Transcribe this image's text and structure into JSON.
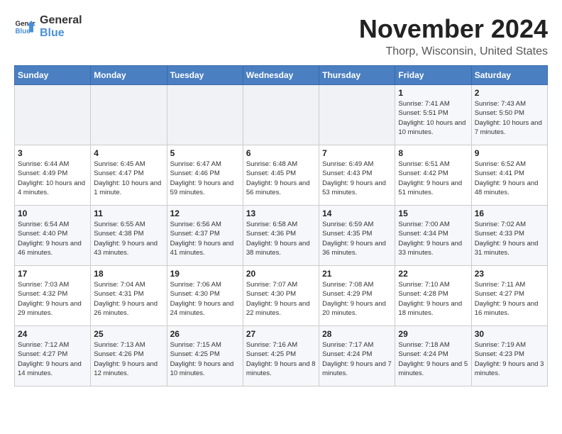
{
  "header": {
    "logo_general": "General",
    "logo_blue": "Blue",
    "month_title": "November 2024",
    "location": "Thorp, Wisconsin, United States"
  },
  "days_of_week": [
    "Sunday",
    "Monday",
    "Tuesday",
    "Wednesday",
    "Thursday",
    "Friday",
    "Saturday"
  ],
  "weeks": [
    [
      {
        "day": "",
        "info": ""
      },
      {
        "day": "",
        "info": ""
      },
      {
        "day": "",
        "info": ""
      },
      {
        "day": "",
        "info": ""
      },
      {
        "day": "",
        "info": ""
      },
      {
        "day": "1",
        "info": "Sunrise: 7:41 AM\nSunset: 5:51 PM\nDaylight: 10 hours and 10 minutes."
      },
      {
        "day": "2",
        "info": "Sunrise: 7:43 AM\nSunset: 5:50 PM\nDaylight: 10 hours and 7 minutes."
      }
    ],
    [
      {
        "day": "3",
        "info": "Sunrise: 6:44 AM\nSunset: 4:49 PM\nDaylight: 10 hours and 4 minutes."
      },
      {
        "day": "4",
        "info": "Sunrise: 6:45 AM\nSunset: 4:47 PM\nDaylight: 10 hours and 1 minute."
      },
      {
        "day": "5",
        "info": "Sunrise: 6:47 AM\nSunset: 4:46 PM\nDaylight: 9 hours and 59 minutes."
      },
      {
        "day": "6",
        "info": "Sunrise: 6:48 AM\nSunset: 4:45 PM\nDaylight: 9 hours and 56 minutes."
      },
      {
        "day": "7",
        "info": "Sunrise: 6:49 AM\nSunset: 4:43 PM\nDaylight: 9 hours and 53 minutes."
      },
      {
        "day": "8",
        "info": "Sunrise: 6:51 AM\nSunset: 4:42 PM\nDaylight: 9 hours and 51 minutes."
      },
      {
        "day": "9",
        "info": "Sunrise: 6:52 AM\nSunset: 4:41 PM\nDaylight: 9 hours and 48 minutes."
      }
    ],
    [
      {
        "day": "10",
        "info": "Sunrise: 6:54 AM\nSunset: 4:40 PM\nDaylight: 9 hours and 46 minutes."
      },
      {
        "day": "11",
        "info": "Sunrise: 6:55 AM\nSunset: 4:38 PM\nDaylight: 9 hours and 43 minutes."
      },
      {
        "day": "12",
        "info": "Sunrise: 6:56 AM\nSunset: 4:37 PM\nDaylight: 9 hours and 41 minutes."
      },
      {
        "day": "13",
        "info": "Sunrise: 6:58 AM\nSunset: 4:36 PM\nDaylight: 9 hours and 38 minutes."
      },
      {
        "day": "14",
        "info": "Sunrise: 6:59 AM\nSunset: 4:35 PM\nDaylight: 9 hours and 36 minutes."
      },
      {
        "day": "15",
        "info": "Sunrise: 7:00 AM\nSunset: 4:34 PM\nDaylight: 9 hours and 33 minutes."
      },
      {
        "day": "16",
        "info": "Sunrise: 7:02 AM\nSunset: 4:33 PM\nDaylight: 9 hours and 31 minutes."
      }
    ],
    [
      {
        "day": "17",
        "info": "Sunrise: 7:03 AM\nSunset: 4:32 PM\nDaylight: 9 hours and 29 minutes."
      },
      {
        "day": "18",
        "info": "Sunrise: 7:04 AM\nSunset: 4:31 PM\nDaylight: 9 hours and 26 minutes."
      },
      {
        "day": "19",
        "info": "Sunrise: 7:06 AM\nSunset: 4:30 PM\nDaylight: 9 hours and 24 minutes."
      },
      {
        "day": "20",
        "info": "Sunrise: 7:07 AM\nSunset: 4:30 PM\nDaylight: 9 hours and 22 minutes."
      },
      {
        "day": "21",
        "info": "Sunrise: 7:08 AM\nSunset: 4:29 PM\nDaylight: 9 hours and 20 minutes."
      },
      {
        "day": "22",
        "info": "Sunrise: 7:10 AM\nSunset: 4:28 PM\nDaylight: 9 hours and 18 minutes."
      },
      {
        "day": "23",
        "info": "Sunrise: 7:11 AM\nSunset: 4:27 PM\nDaylight: 9 hours and 16 minutes."
      }
    ],
    [
      {
        "day": "24",
        "info": "Sunrise: 7:12 AM\nSunset: 4:27 PM\nDaylight: 9 hours and 14 minutes."
      },
      {
        "day": "25",
        "info": "Sunrise: 7:13 AM\nSunset: 4:26 PM\nDaylight: 9 hours and 12 minutes."
      },
      {
        "day": "26",
        "info": "Sunrise: 7:15 AM\nSunset: 4:25 PM\nDaylight: 9 hours and 10 minutes."
      },
      {
        "day": "27",
        "info": "Sunrise: 7:16 AM\nSunset: 4:25 PM\nDaylight: 9 hours and 8 minutes."
      },
      {
        "day": "28",
        "info": "Sunrise: 7:17 AM\nSunset: 4:24 PM\nDaylight: 9 hours and 7 minutes."
      },
      {
        "day": "29",
        "info": "Sunrise: 7:18 AM\nSunset: 4:24 PM\nDaylight: 9 hours and 5 minutes."
      },
      {
        "day": "30",
        "info": "Sunrise: 7:19 AM\nSunset: 4:23 PM\nDaylight: 9 hours and 3 minutes."
      }
    ]
  ]
}
